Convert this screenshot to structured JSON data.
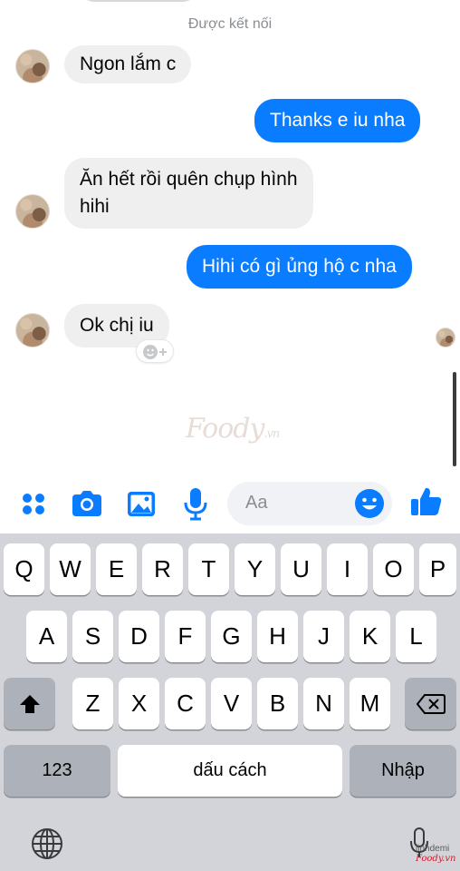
{
  "status": "Được kết nối",
  "messages": [
    {
      "dir": "in",
      "text": "Ngon lắm c"
    },
    {
      "dir": "out",
      "text": "Thanks e iu nha"
    },
    {
      "dir": "in",
      "line1": "Ăn hết rồi quên chụp hình",
      "line2": "hihi"
    },
    {
      "dir": "out",
      "text": "Hihi có gì ủng hộ c nha"
    },
    {
      "dir": "in",
      "text": "Ok chị iu"
    }
  ],
  "watermark": {
    "brand": "Foody",
    "suffix": ".vn"
  },
  "composer": {
    "placeholder": "Aa",
    "icons": [
      "apps-icon",
      "camera-icon",
      "image-icon",
      "microphone-icon",
      "emoji-icon",
      "thumbs-up-icon"
    ],
    "accent": "#0a7cff"
  },
  "keyboard": {
    "row1": [
      "Q",
      "W",
      "E",
      "R",
      "T",
      "Y",
      "U",
      "I",
      "O",
      "P"
    ],
    "row2": [
      "A",
      "S",
      "D",
      "F",
      "G",
      "H",
      "J",
      "K",
      "L"
    ],
    "row3": [
      "Z",
      "X",
      "C",
      "V",
      "B",
      "N",
      "M"
    ],
    "numbers_label": "123",
    "space_label": "dấu cách",
    "return_label": "Nhập"
  },
  "corner_watermark": {
    "line1": "linhdemi",
    "line2": "Foody.vn"
  }
}
